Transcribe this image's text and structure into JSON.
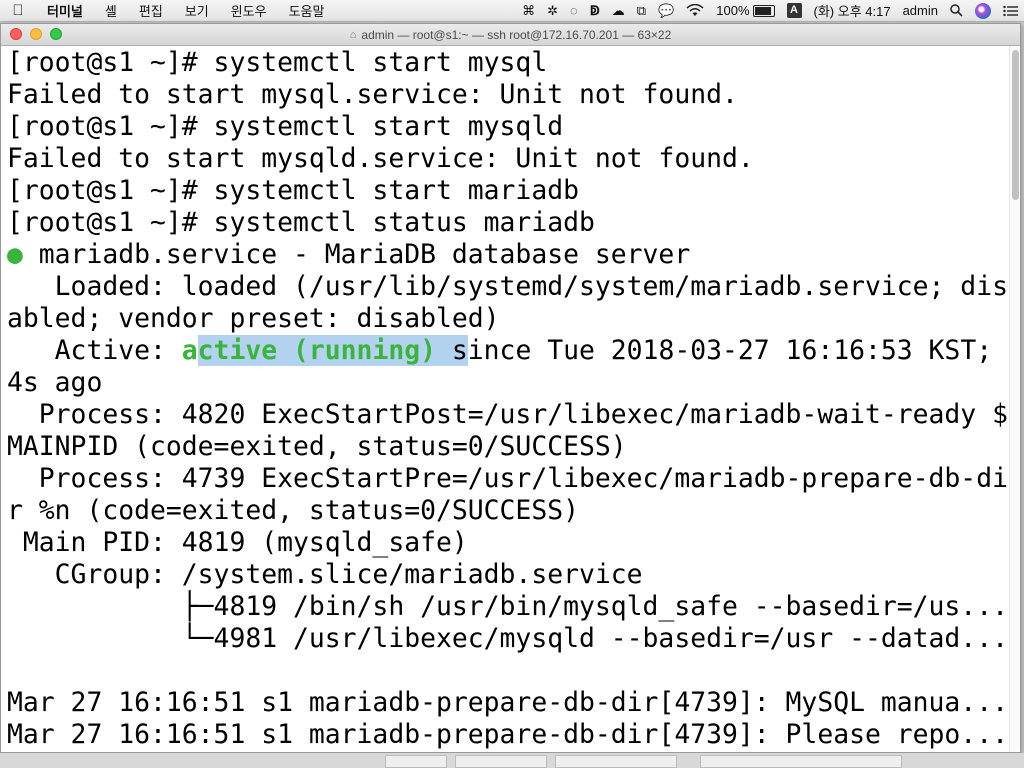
{
  "menubar": {
    "app_name": "터미널",
    "items": [
      "셸",
      "편집",
      "보기",
      "윈도우",
      "도움말"
    ],
    "status": {
      "battery_percent": "100%",
      "battery_level": 1.0,
      "input_source": "A",
      "datetime": "(화) 오후 4:17",
      "user": "admin"
    }
  },
  "window": {
    "title": "admin — root@s1:~ — ssh root@172.16.70.201 — 63×22"
  },
  "terminal": {
    "lines": [
      [
        {
          "t": "[root@s1 ~]# systemctl start mysql"
        }
      ],
      [
        {
          "t": "Failed to start mysql.service: Unit not found."
        }
      ],
      [
        {
          "t": "[root@s1 ~]# systemctl start mysqld"
        }
      ],
      [
        {
          "t": "Failed to start mysqld.service: Unit not found."
        }
      ],
      [
        {
          "t": "[root@s1 ~]# systemctl start mariadb"
        }
      ],
      [
        {
          "t": "[root@s1 ~]# systemctl status mariadb"
        }
      ],
      [
        {
          "t": "●",
          "c": "green"
        },
        {
          "t": " mariadb.service - MariaDB database server"
        }
      ],
      [
        {
          "t": "   Loaded: loaded (/usr/lib/systemd/system/mariadb.service; dis"
        }
      ],
      [
        {
          "t": "abled; vendor preset: disabled)"
        }
      ],
      [
        {
          "t": "   Active: "
        },
        {
          "t": "a",
          "c": "green"
        },
        {
          "t": "ctive (running)",
          "c": "green sel"
        },
        {
          "t": " s",
          "c": "sel"
        },
        {
          "t": "ince Tue 2018-03-27 16:16:53 KST;"
        }
      ],
      [
        {
          "t": "4s ago"
        }
      ],
      [
        {
          "t": "  Process: 4820 ExecStartPost=/usr/libexec/mariadb-wait-ready $"
        }
      ],
      [
        {
          "t": "MAINPID (code=exited, status=0/SUCCESS)"
        }
      ],
      [
        {
          "t": "  Process: 4739 ExecStartPre=/usr/libexec/mariadb-prepare-db-di"
        }
      ],
      [
        {
          "t": "r %n (code=exited, status=0/SUCCESS)"
        }
      ],
      [
        {
          "t": " Main PID: 4819 (mysqld_safe)"
        }
      ],
      [
        {
          "t": "   CGroup: /system.slice/mariadb.service"
        }
      ],
      [
        {
          "t": "           ├─4819 /bin/sh /usr/bin/mysqld_safe --basedir=/us..."
        }
      ],
      [
        {
          "t": "           └─4981 /usr/libexec/mysqld --basedir=/usr --datad..."
        }
      ],
      [
        {
          "t": ""
        }
      ],
      [
        {
          "t": "Mar 27 16:16:51 s1 mariadb-prepare-db-dir[4739]: MySQL manua..."
        }
      ],
      [
        {
          "t": "Mar 27 16:16:51 s1 mariadb-prepare-db-dir[4739]: Please repo..."
        }
      ]
    ]
  }
}
